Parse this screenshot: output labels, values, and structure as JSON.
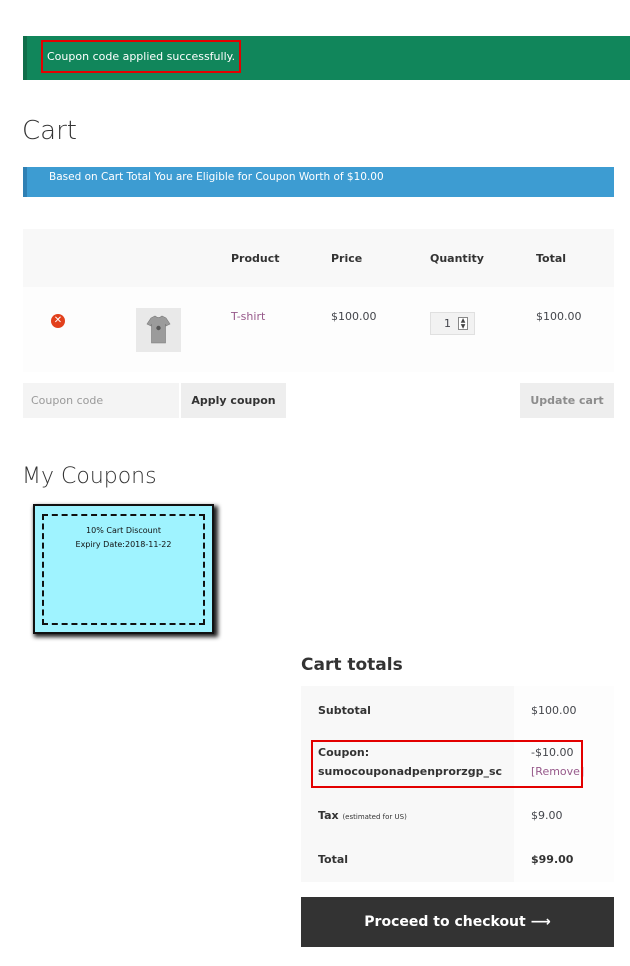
{
  "notices": {
    "success": "Coupon code applied successfully.",
    "info": "Based on Cart Total You are Eligible for Coupon Worth of $10.00"
  },
  "page": {
    "title": "Cart"
  },
  "cart_table": {
    "headers": [
      "Product",
      "Price",
      "Quantity",
      "Total"
    ],
    "rows": [
      {
        "product": "T-shirt",
        "price": "$100.00",
        "quantity": "1",
        "total": "$100.00"
      }
    ]
  },
  "coupon_form": {
    "placeholder": "Coupon code",
    "apply_label": "Apply coupon",
    "update_label": "Update cart"
  },
  "my_coupons": {
    "title": "My Coupons",
    "cards": [
      {
        "name": "10% Cart Discount",
        "expiry": "Expiry Date:2018-11-22"
      }
    ]
  },
  "cart_totals": {
    "title": "Cart totals",
    "subtotal_label": "Subtotal",
    "subtotal_value": "$100.00",
    "coupon_label": "Coupon:",
    "coupon_code": "sumocouponadpenprorzgp_sc",
    "coupon_value": "-$10.00",
    "coupon_remove": "[Remove]",
    "tax_label": "Tax",
    "tax_note": "(estimated for US)",
    "tax_value": "$9.00",
    "total_label": "Total",
    "total_value": "$99.00"
  },
  "checkout": {
    "label": "Proceed to checkout",
    "arrow": "⟶"
  },
  "colors": {
    "success": "#11865b",
    "info": "#3d9cd2",
    "highlight": "#e30000",
    "link": "#96588a",
    "coupon_card": "#9ff3ff",
    "checkout": "#333333"
  }
}
